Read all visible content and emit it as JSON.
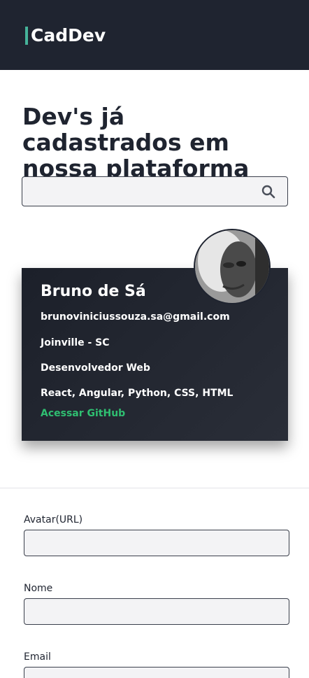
{
  "header": {
    "logo": "CadDev"
  },
  "main": {
    "title": "Dev's já cadastrados em nossa plataforma",
    "search": {
      "value": "",
      "placeholder": "",
      "icon": "search-icon"
    }
  },
  "dev_card": {
    "name": "Bruno de Sá",
    "email": "brunoviniciussouza.sa@gmail.com",
    "location": "Joinville - SC",
    "role": "Desenvolvedor Web",
    "skills": "React, Angular, Python, CSS, HTML",
    "github_link": "Acessar GitHub"
  },
  "form": {
    "fields": [
      {
        "label": "Avatar(URL)",
        "value": ""
      },
      {
        "label": "Nome",
        "value": ""
      },
      {
        "label": "Email",
        "value": ""
      }
    ]
  },
  "colors": {
    "header_bg": "#1f2430",
    "accent": "#46b39a",
    "link": "#2fbf71"
  }
}
